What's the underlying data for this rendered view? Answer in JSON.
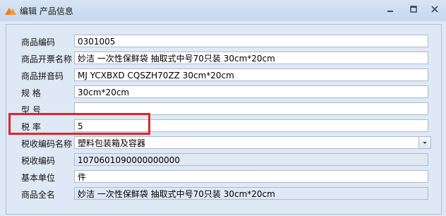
{
  "window": {
    "title": "编辑 产品信息",
    "accent_color": "#f07a1a",
    "controls": [
      "minimize-icon",
      "maximize-icon",
      "close-icon"
    ]
  },
  "form": {
    "fields": [
      {
        "label": "商品编码",
        "value": "0301005"
      },
      {
        "label": "商品开票名称",
        "value": "妙洁 一次性保鲜袋 抽取式中号70只装 30cm*20cm"
      },
      {
        "label": "商品拼音码",
        "value": "MJ YCXBXD CQSZH70ZZ 30cm*20cm"
      },
      {
        "label": "规  格",
        "value": "30cm*20cm"
      },
      {
        "label": "型  号",
        "value": ""
      },
      {
        "label": "税  率",
        "value": "5"
      },
      {
        "label": "税收编码名称",
        "value": "塑料包装箱及容器"
      },
      {
        "label": "税收编码",
        "value": "1070601090000000000"
      },
      {
        "label": "基本单位",
        "value": "件"
      },
      {
        "label": "商品全名",
        "value": "妙洁 一次性保鲜袋 抽取式中号70只装 30cm*20cm"
      }
    ]
  },
  "highlight_color": "#e0252b"
}
